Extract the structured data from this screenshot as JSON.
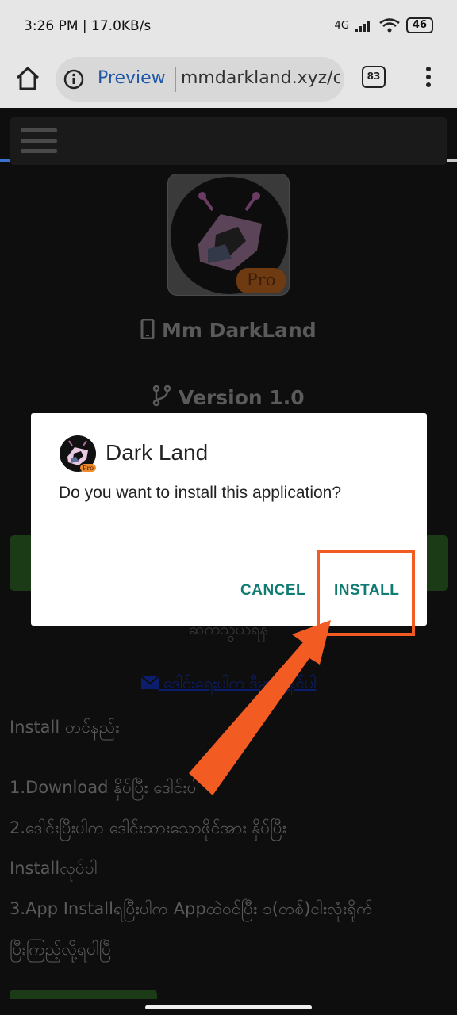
{
  "status_bar": {
    "time": "3:26 PM | 17.0KB/s",
    "network": "4G",
    "battery": "46"
  },
  "browser": {
    "preview_label": "Preview",
    "url": "mmdarkland.xyz/c",
    "tab_count": "83",
    "load_progress": 0.4
  },
  "page": {
    "app_badge": "Pro",
    "app_name": "Mm DarkLand",
    "version": "Version 1.0",
    "hidden_line": "ဆက်သွယ်ရန်",
    "mail_link": "ဒေါင်းရေးပါက ဒီမှာ ပို့နိုင်ပါ",
    "install_heading": "Install တင်နည်း",
    "steps": [
      "1.Download နှိပ်ပြီး ဒေါင်းပါ",
      "2.ဒေါင်းပြီးပါက ဒေါင်းထားသောဖိုင်အား နှိပ်ပြီး",
      "Installလုပ်ပါ",
      "3.App Installရပြီးပါက Appထဲဝင်ပြီး ၁(တစ်)ငါးလုံးရိုက်",
      "ပြီးကြည့်လို့ရပါပြီ"
    ]
  },
  "dialog": {
    "title": "Dark Land",
    "message": "Do you want to install this application?",
    "cancel_label": "CANCEL",
    "install_label": "INSTALL"
  },
  "colors": {
    "accent": "#107b73",
    "annotation": "#f25b22",
    "browser_link": "#1f57a6"
  }
}
